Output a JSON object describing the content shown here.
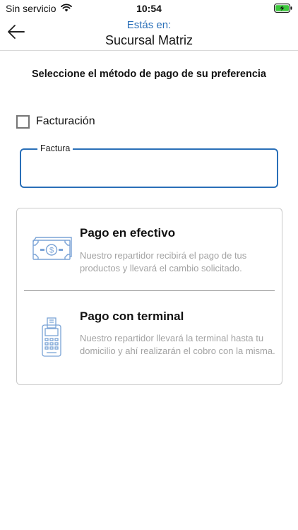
{
  "status_bar": {
    "carrier": "Sin servicio",
    "time": "10:54",
    "battery_color": "#3cc83c"
  },
  "header": {
    "subtitle": "Estás en:",
    "title": "Sucursal Matriz",
    "accent_color": "#2a6fb8"
  },
  "main": {
    "heading": "Seleccione el método de pago de su preferencia",
    "billing_checkbox": {
      "label": "Facturación",
      "checked": false
    },
    "invoice_field": {
      "label": "Factura",
      "value": ""
    },
    "payment_options": [
      {
        "icon": "cash-icon",
        "title": "Pago en efectivo",
        "description": "Nuestro repartidor recibirá el pago de tus productos y llevará el cambio solicitado."
      },
      {
        "icon": "card-terminal-icon",
        "title": "Pago con terminal",
        "description": "Nuestro repartidor llevará la terminal hasta tu domicilio y ahí realizarán el cobro con la misma."
      }
    ]
  }
}
